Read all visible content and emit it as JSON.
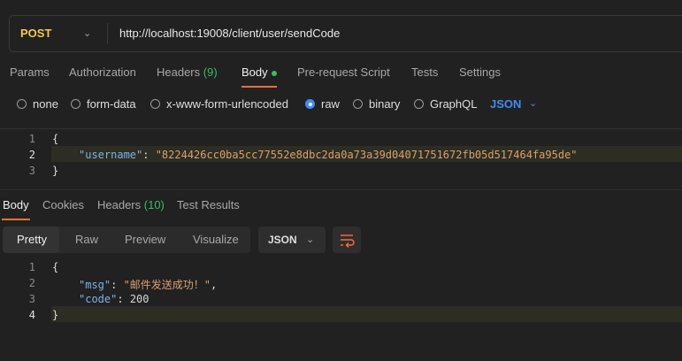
{
  "request": {
    "method": "POST",
    "url": "http://localhost:19008/client/user/sendCode"
  },
  "request_tabs": [
    {
      "label": "Params"
    },
    {
      "label": "Authorization"
    },
    {
      "label": "Headers",
      "count": "(9)"
    },
    {
      "label": "Body"
    },
    {
      "label": "Pre-request Script"
    },
    {
      "label": "Tests"
    },
    {
      "label": "Settings"
    }
  ],
  "body_types": [
    "none",
    "form-data",
    "x-www-form-urlencoded",
    "raw",
    "binary",
    "GraphQL"
  ],
  "body_type_selected": "raw",
  "body_format": "JSON",
  "request_body": {
    "line_numbers": [
      "1",
      "2",
      "3"
    ],
    "open": "{",
    "key": "\"username\"",
    "colon": ": ",
    "value": "\"8224426cc0ba5cc77552e8dbc2da0a73a39d04071751672fb05d517464fa95de\"",
    "close": "}"
  },
  "response_tabs": [
    {
      "label": "Body"
    },
    {
      "label": "Cookies"
    },
    {
      "label": "Headers",
      "count": "(10)"
    },
    {
      "label": "Test Results"
    }
  ],
  "view_modes": [
    "Pretty",
    "Raw",
    "Preview",
    "Visualize"
  ],
  "response_format": "JSON",
  "response_body": {
    "line_numbers": [
      "1",
      "2",
      "3",
      "4"
    ],
    "open": "{",
    "msg_key": "\"msg\"",
    "msg_value": "\"邮件发送成功！\"",
    "code_key": "\"code\"",
    "code_value": "200",
    "close": "}"
  },
  "colors": {
    "accent": "#ff6c37",
    "method": "#f2c94c",
    "link": "#3d8ef0",
    "count": "#3cba66"
  }
}
